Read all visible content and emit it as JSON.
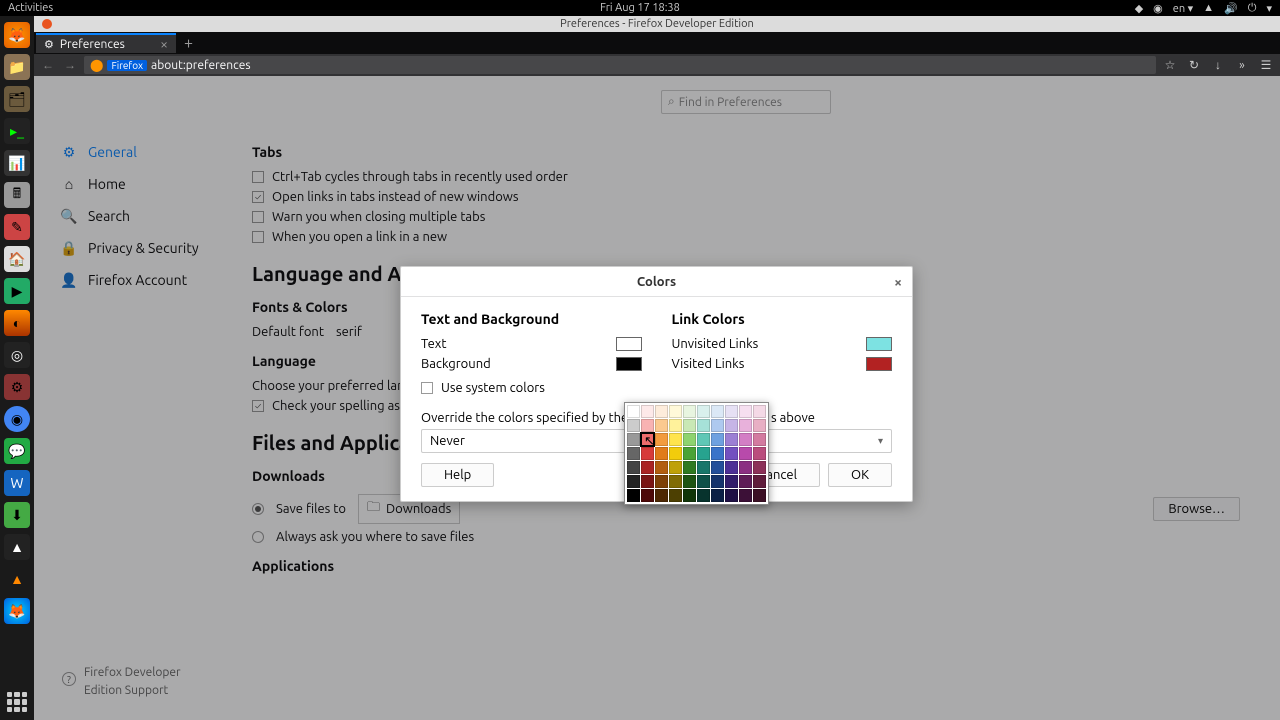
{
  "topbar": {
    "activities": "Activities",
    "clock": "Fri Aug 17  18:38",
    "lang": "en"
  },
  "window": {
    "title": "Preferences - Firefox Developer Edition"
  },
  "tab": {
    "label": "Preferences"
  },
  "url": {
    "badge": "Firefox",
    "path": "about:preferences"
  },
  "search": {
    "placeholder": "Find in Preferences"
  },
  "sidebar": {
    "items": [
      {
        "icon": "⚙",
        "label": "General"
      },
      {
        "icon": "⌂",
        "label": "Home"
      },
      {
        "icon": "🔍",
        "label": "Search"
      },
      {
        "icon": "🔒",
        "label": "Privacy & Security"
      },
      {
        "icon": "👤",
        "label": "Firefox Account"
      }
    ],
    "support": "Firefox Developer Edition Support"
  },
  "prefs": {
    "tabs_h": "Tabs",
    "tabs_cb1": "Ctrl+Tab cycles through tabs in recently used order",
    "tabs_cb2": "Open links in tabs instead of new windows",
    "tabs_cb3": "Warn you when closing multiple tabs",
    "tabs_cb4": "When you open a link in a new",
    "lang_h": "Language and Appeara",
    "fonts_h": "Fonts & Colors",
    "default_font_lbl": "Default font",
    "default_font_val": "serif",
    "lang_sub": "Language",
    "lang_desc": "Choose your preferred language",
    "spell": "Check your spelling as you typ",
    "files_h": "Files and Applications",
    "downloads_h": "Downloads",
    "save_to": "Save files to",
    "save_folder": "Downloads",
    "browse": "Browse…",
    "always_ask": "Always ask you where to save files",
    "apps_h": "Applications"
  },
  "modal": {
    "title": "Colors",
    "h_left": "Text and Background",
    "h_right": "Link Colors",
    "text_lbl": "Text",
    "text_color": "#ffffff",
    "bg_lbl": "Background",
    "bg_color": "#000000",
    "sys": "Use system colors",
    "unvisited": "Unvisited Links",
    "unvisited_color": "#7de2e2",
    "visited": "Visited Links",
    "visited_color": "#b22222",
    "override": "Override the colors specified by the",
    "override_tail": "s above",
    "select_val": "Never",
    "help": "Help",
    "cancel": "Cancel",
    "ok": "OK"
  },
  "picker": {
    "rows": [
      [
        "#ffffff",
        "#fde9e9",
        "#fdecdb",
        "#fff9d9",
        "#e8f5e0",
        "#d9f0ed",
        "#dbe8f6",
        "#e6e0f4",
        "#f6dff0",
        "#f4d9e6"
      ],
      [
        "#cccccc",
        "#f8b2b2",
        "#fbc98f",
        "#fff29b",
        "#c9e8b5",
        "#a6e1d8",
        "#aec9ef",
        "#c6b4e6",
        "#e8b1db",
        "#e8afc4"
      ],
      [
        "#999999",
        "#ee6b6b",
        "#f29b3e",
        "#ffe44d",
        "#8ed36f",
        "#5fc7b6",
        "#6fa1e0",
        "#9c7fd4",
        "#d37ec5",
        "#d37ba0"
      ],
      [
        "#666666",
        "#d73a3a",
        "#e07b1a",
        "#f2cc0c",
        "#4aa336",
        "#27a38f",
        "#3a73c9",
        "#7350c0",
        "#b84aab",
        "#ba4d7d"
      ],
      [
        "#444444",
        "#aa2323",
        "#b25e0f",
        "#bfa108",
        "#2f7a21",
        "#18766a",
        "#244f9a",
        "#4d2f96",
        "#8b2f82",
        "#8c3159"
      ],
      [
        "#222222",
        "#7a1414",
        "#7d4007",
        "#806b05",
        "#1d5413",
        "#0e5048",
        "#15336b",
        "#321c6a",
        "#5e1c57",
        "#5f1c3b"
      ],
      [
        "#000000",
        "#4d0808",
        "#4d2703",
        "#4d4002",
        "#113509",
        "#07332d",
        "#0b2046",
        "#1f1045",
        "#3c1037",
        "#3c1025"
      ]
    ],
    "selected": [
      2,
      1
    ]
  }
}
